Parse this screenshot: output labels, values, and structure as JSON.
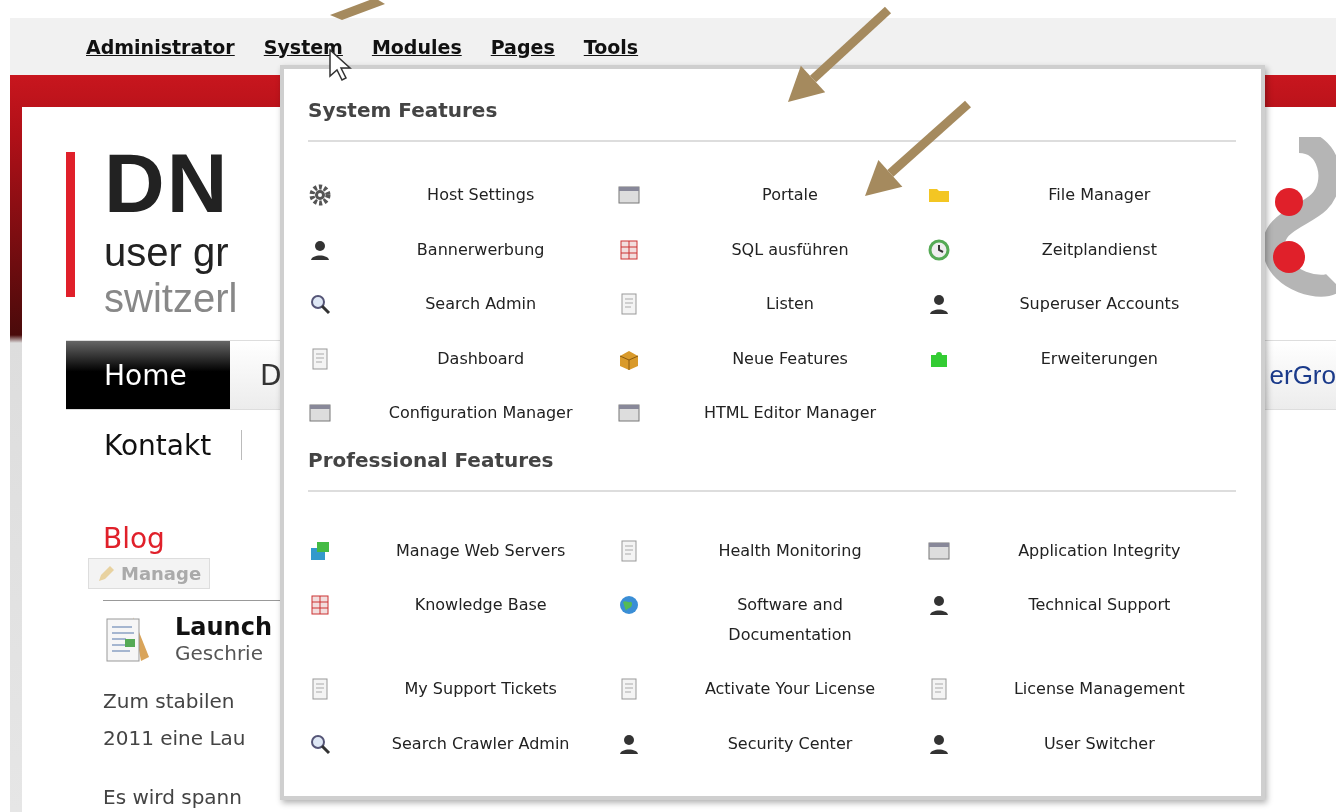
{
  "top_menu": [
    {
      "label": "Administrator"
    },
    {
      "label": "System"
    },
    {
      "label": "Modules"
    },
    {
      "label": "Pages"
    },
    {
      "label": "Tools"
    }
  ],
  "page": {
    "logo": {
      "title": "DN",
      "line1": "user gr",
      "line2": "switzerl"
    },
    "nav": [
      {
        "label": "Home",
        "selected": true
      },
      {
        "label": "D",
        "selected": false
      }
    ],
    "nav_right": "erGro",
    "subnav": [
      "Kontakt"
    ],
    "blog": {
      "title": "Blog",
      "manage": "Manage",
      "post_title": "Launch",
      "post_meta": "Geschrie",
      "paragraphs": [
        [
          "Zum stabilen",
          "2011 eine Lau"
        ],
        [
          "Es wird spann"
        ]
      ]
    }
  },
  "dropdown": {
    "sections": [
      {
        "title": "System Features",
        "items": [
          "Host Settings",
          "Portale",
          "File Manager",
          "Bannerwerbung",
          "SQL ausführen",
          "Zeitplandienst",
          "Search Admin",
          "Listen",
          "Superuser Accounts",
          "Dashboard",
          "Neue Features",
          "Erweiterungen",
          "Configuration Manager",
          "HTML Editor Manager"
        ]
      },
      {
        "title": "Professional Features",
        "items": [
          "Manage Web Servers",
          "Health Monitoring",
          "Application Integrity",
          "Knowledge Base",
          "Software and Documentation",
          "Technical Support",
          "My Support Tickets",
          "Activate Your License",
          "License Management",
          "Search Crawler Admin",
          "Security Center",
          "User Switcher"
        ]
      }
    ]
  }
}
